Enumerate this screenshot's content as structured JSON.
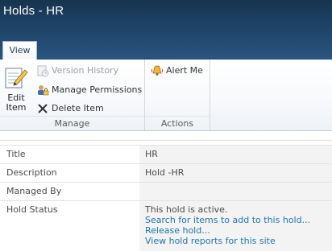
{
  "window": {
    "title": "Holds - HR"
  },
  "tabs": [
    {
      "label": "View"
    }
  ],
  "ribbon": {
    "groups": [
      {
        "label": "Manage",
        "large_button": {
          "label_line1": "Edit",
          "label_line2": "Item",
          "icon": "edit-item-icon"
        },
        "small_buttons": [
          {
            "label": "Version History",
            "icon": "version-history-icon",
            "enabled": false
          },
          {
            "label": "Manage Permissions",
            "icon": "manage-permissions-icon",
            "enabled": true
          },
          {
            "label": "Delete Item",
            "icon": "delete-x-icon",
            "enabled": true
          }
        ]
      },
      {
        "label": "Actions",
        "small_buttons": [
          {
            "label": "Alert Me",
            "icon": "alert-bell-icon",
            "enabled": true
          }
        ]
      }
    ]
  },
  "properties": [
    {
      "label": "Title",
      "value": "HR"
    },
    {
      "label": "Description",
      "value": "Hold -HR"
    },
    {
      "label": "Managed By",
      "value": ""
    },
    {
      "label": "Hold Status",
      "value": "This hold is active.",
      "links": [
        "Search for items to add to this hold...",
        "Release hold...",
        "View hold reports for this site"
      ]
    }
  ],
  "colors": {
    "title_bar": "#21466b",
    "link": "#1f75a8",
    "value_bg": "#f3f3f3"
  }
}
